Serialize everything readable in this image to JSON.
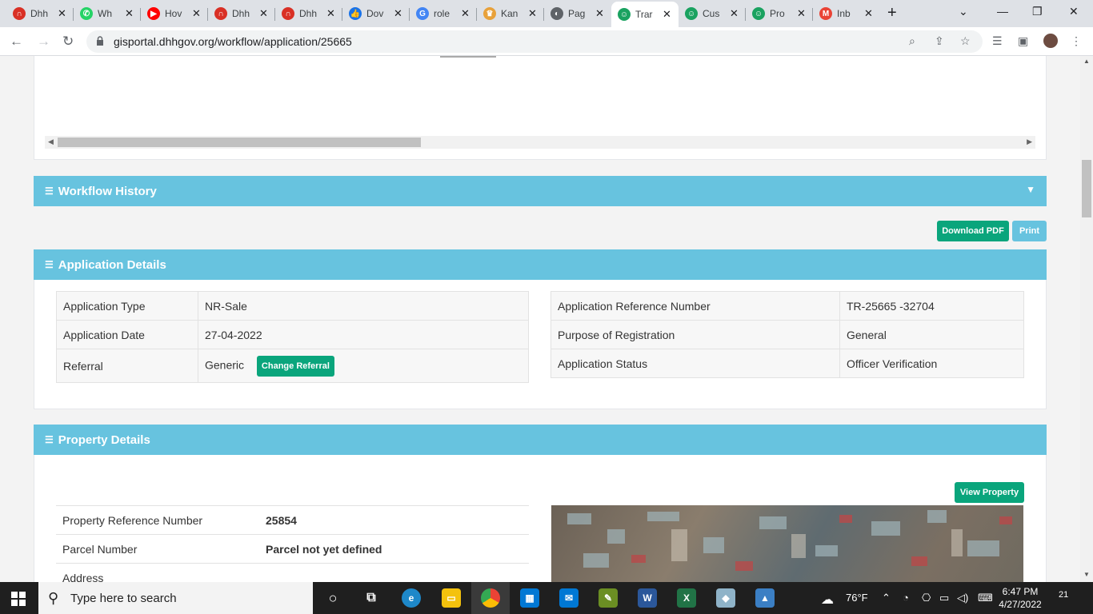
{
  "browser": {
    "tabs": [
      {
        "title": "Dhh",
        "color": "#d93025",
        "glyph": "∩"
      },
      {
        "title": "Wh",
        "color": "#25d366",
        "glyph": "✆"
      },
      {
        "title": "Hov",
        "color": "#ff0000",
        "glyph": "▶"
      },
      {
        "title": "Dhh",
        "color": "#d93025",
        "glyph": "∩"
      },
      {
        "title": "Dhh",
        "color": "#d93025",
        "glyph": "∩"
      },
      {
        "title": "Dov",
        "color": "#1a73e8",
        "glyph": "👍"
      },
      {
        "title": "role",
        "color": "#4285f4",
        "glyph": "G"
      },
      {
        "title": "Kan",
        "color": "#e8a13a",
        "glyph": "♛"
      },
      {
        "title": "Pag",
        "color": "#5f6368",
        "glyph": "◐"
      },
      {
        "title": "Trar",
        "color": "#1aa260",
        "glyph": "☺"
      },
      {
        "title": "Cus",
        "color": "#1aa260",
        "glyph": "☺"
      },
      {
        "title": "Pro",
        "color": "#1aa260",
        "glyph": "☺"
      },
      {
        "title": "Inb",
        "color": "#ea4335",
        "glyph": "M"
      }
    ],
    "url": "gisportal.dhhgov.org/workflow/application/25665"
  },
  "workflow_history": {
    "title": "Workflow History"
  },
  "actions": {
    "download_pdf": "Download PDF",
    "print": "Print"
  },
  "application_details": {
    "title": "Application Details",
    "left": [
      {
        "label": "Application Type",
        "value": "NR-Sale"
      },
      {
        "label": "Application Date",
        "value": "27-04-2022"
      },
      {
        "label": "Referral",
        "value": "Generic"
      }
    ],
    "change_referral": "Change Referral",
    "right": [
      {
        "label": "Application Reference Number",
        "value": "TR-25665 -32704"
      },
      {
        "label": "Purpose of Registration",
        "value": "General"
      },
      {
        "label": "Application Status",
        "value": "Officer Verification"
      }
    ]
  },
  "property_details": {
    "title": "Property Details",
    "view_property": "View Property",
    "rows": [
      {
        "label": "Property Reference Number",
        "value": "25854"
      },
      {
        "label": "Parcel Number",
        "value": "Parcel not yet defined"
      },
      {
        "label": "Address",
        "value": ""
      }
    ]
  },
  "taskbar": {
    "search_placeholder": "Type here to search",
    "weather": "76°F",
    "time": "6:47 PM",
    "date": "4/27/2022",
    "notifications": "21"
  }
}
